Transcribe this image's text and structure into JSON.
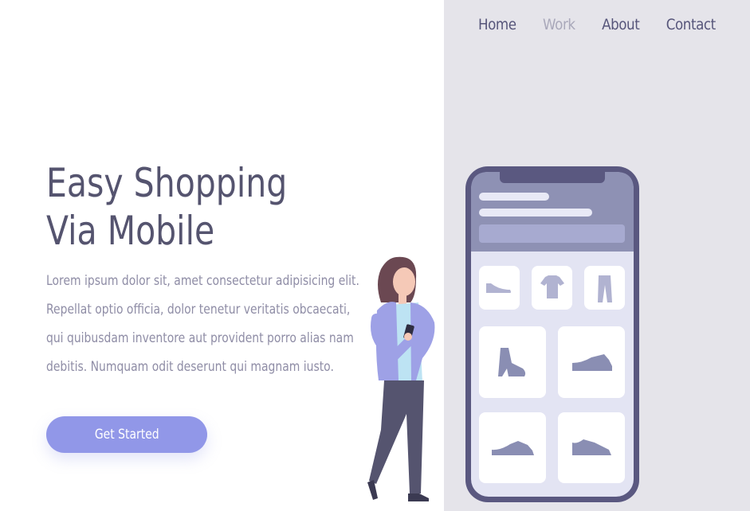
{
  "nav": {
    "items": [
      {
        "label": "Home",
        "active": false
      },
      {
        "label": "Work",
        "active": true
      },
      {
        "label": "About",
        "active": false
      },
      {
        "label": "Contact",
        "active": false
      }
    ]
  },
  "hero": {
    "title_line1": "Easy Shopping",
    "title_line2": "Via Mobile",
    "description": "Lorem ipsum dolor sit, amet consectetur adipisicing elit. Repellat optio officia, dolor tenetur veritatis obcaecati, qui quibusdam inventore aut provident porro alias nam debitis. Numquam odit deserunt qui magnam iusto.",
    "cta_label": "Get Started"
  },
  "colors": {
    "accent": "#9197e8",
    "title": "#55546f",
    "panel": "#e5e4ea",
    "phone_frame": "#5a5880"
  },
  "illustration": {
    "icons": [
      "shoe-icon",
      "tshirt-icon",
      "pants-icon",
      "boot-icon",
      "sneaker-icon",
      "sneaker-icon",
      "sneaker-icon"
    ]
  }
}
